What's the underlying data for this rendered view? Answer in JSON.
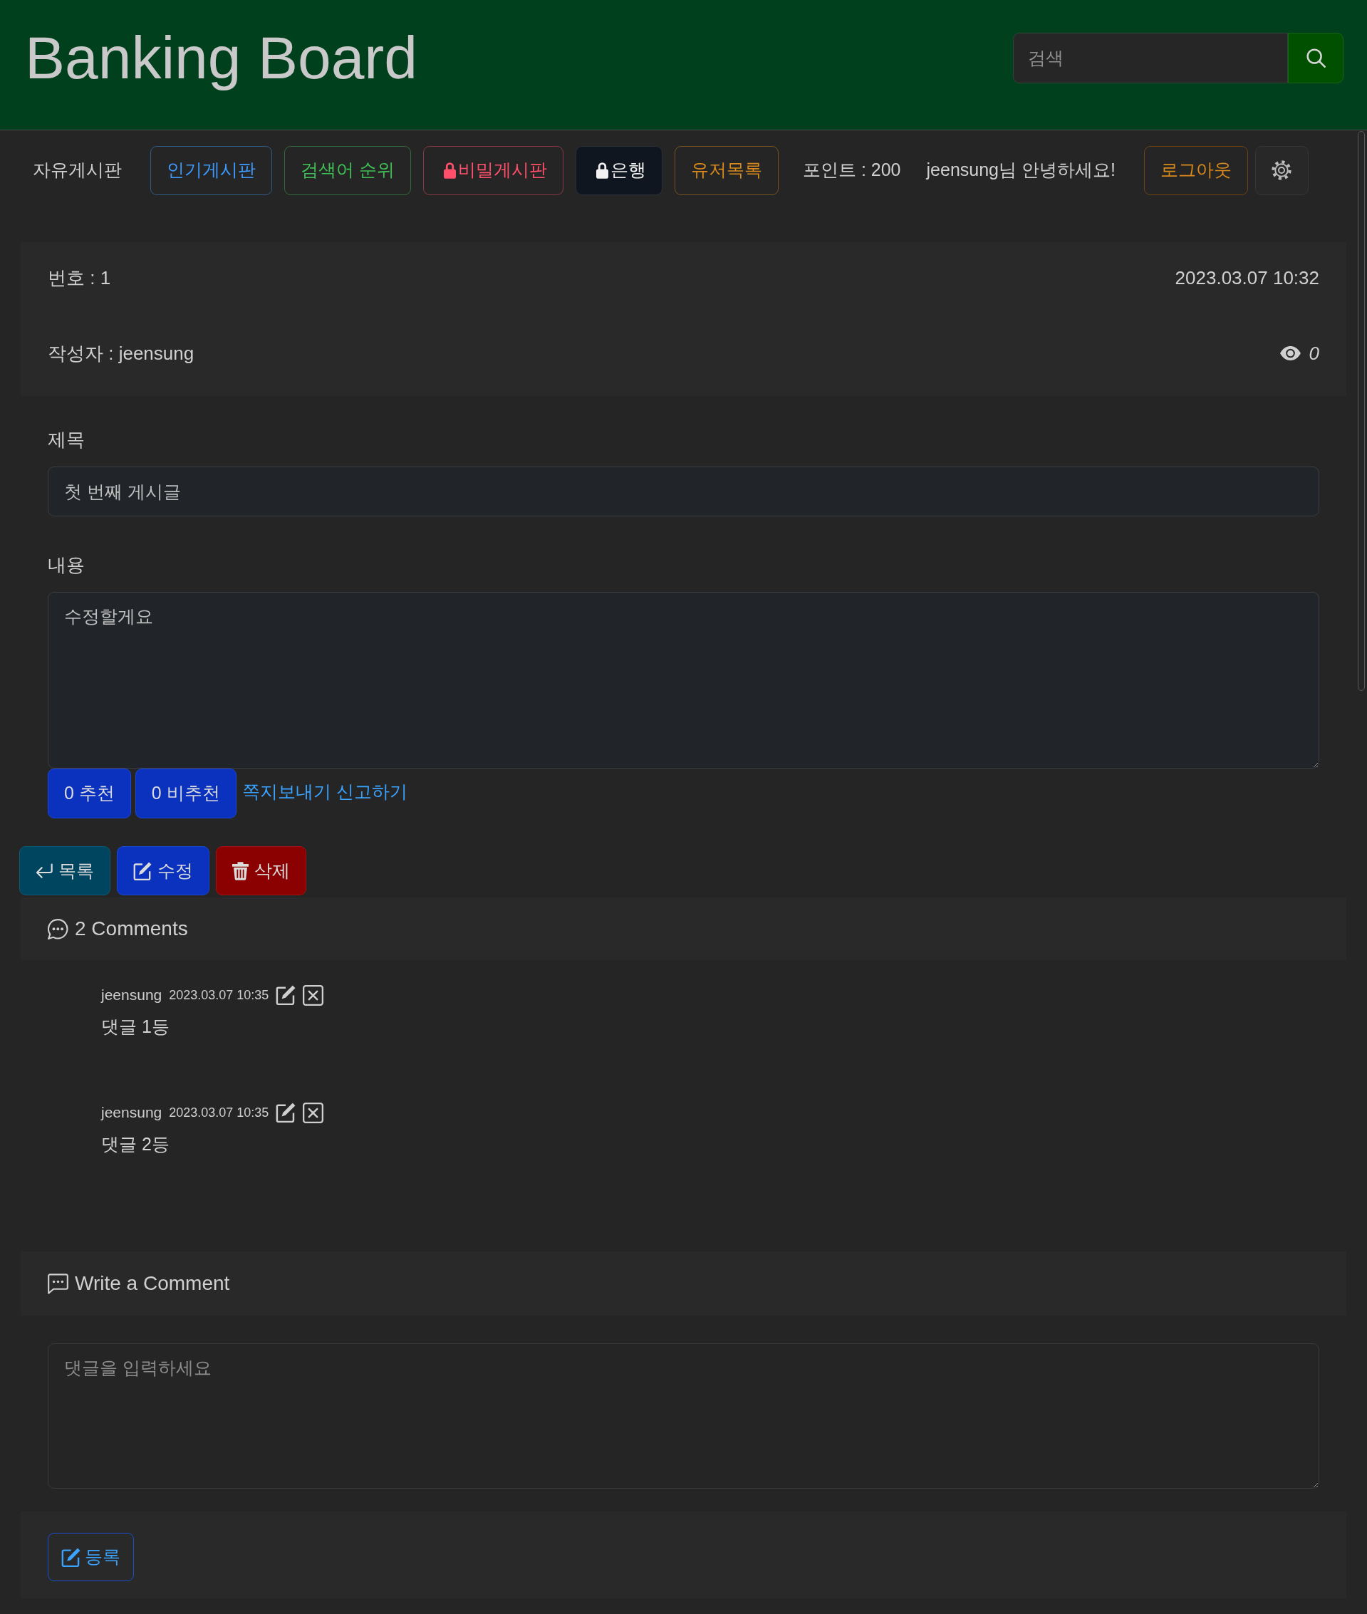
{
  "header": {
    "title": "Banking Board",
    "search": {
      "placeholder": "검색"
    }
  },
  "nav": {
    "boards": [
      {
        "label": "자유게시판",
        "kind": "link",
        "locked": false
      },
      {
        "label": "인기게시판",
        "kind": "outline",
        "color": "#3d9bff",
        "locked": false
      },
      {
        "label": "검색어 순위",
        "kind": "outline",
        "color": "#3fbf55",
        "locked": false
      },
      {
        "label": "비밀게시판",
        "kind": "outline",
        "color": "#ff4f6b",
        "locked": true
      },
      {
        "label": "은행",
        "kind": "dark",
        "locked": true
      },
      {
        "label": "유저목록",
        "kind": "outline",
        "color": "#d98a1c",
        "locked": false
      }
    ],
    "points": "포인트 : 200",
    "greeting": "jeensung님 안녕하세요!",
    "logout": "로그아웃"
  },
  "post": {
    "number": "번호 : 1",
    "date": "2023.03.07 10:32",
    "author": "작성자 : jeensung",
    "views": "0",
    "title_label": "제목",
    "title": "첫 번째 게시글",
    "content_label": "내용",
    "content": "수정할게요",
    "votes": [
      {
        "label": "0 추천"
      },
      {
        "label": "0 비추천"
      }
    ],
    "links": [
      {
        "label": "쪽지보내기"
      },
      {
        "label": "신고하기"
      }
    ]
  },
  "actions": [
    {
      "label": "목록",
      "kind": "list"
    },
    {
      "label": "수정",
      "kind": "edit"
    },
    {
      "label": "삭제",
      "kind": "delete"
    }
  ],
  "comments": {
    "heading": "2 Comments",
    "items": [
      {
        "author": "jeensung",
        "date": "2023.03.07 10:35",
        "text": "댓글 1등"
      },
      {
        "author": "jeensung",
        "date": "2023.03.07 10:35",
        "text": "댓글 2등"
      }
    ]
  },
  "comment_form": {
    "heading": "Write a Comment",
    "placeholder": "댓글을 입력하세요",
    "submit": "등록"
  }
}
